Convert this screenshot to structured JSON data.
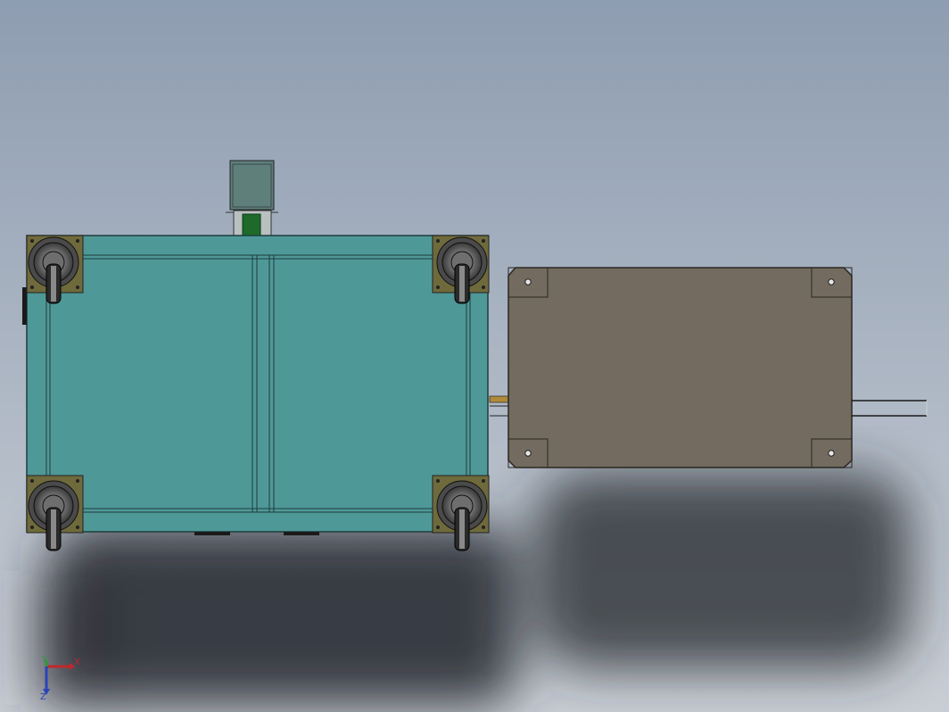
{
  "viewport": {
    "background_top": "#8e9db1",
    "background_bottom": "#c9ced5"
  },
  "colors": {
    "frame_fill": "#4f9898",
    "frame_edge": "#1f3d3d",
    "plate_fill": "#736b5f",
    "plate_edge": "#2a2722",
    "caster_mount": "#6f6a3c",
    "caster_body": "#8a8a8a",
    "motor_body": "#5f7f7b",
    "motor_coupler": "#1d6a2a",
    "shadow": "#2d3036",
    "axis_x": "#c0282d",
    "axis_y": "#2e9a3a",
    "axis_z": "#2b43b8"
  },
  "triad": {
    "x_label": "X",
    "y_label": "Y",
    "z_label": "Z"
  }
}
